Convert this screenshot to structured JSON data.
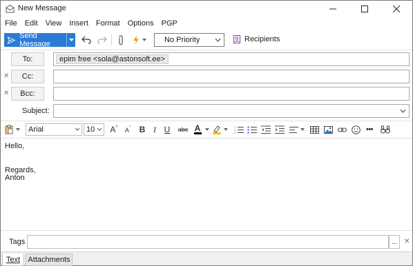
{
  "window": {
    "title": "New Message"
  },
  "menu": [
    "File",
    "Edit",
    "View",
    "Insert",
    "Format",
    "Options",
    "PGP"
  ],
  "toolbar": {
    "send_label": "Send Message",
    "priority_value": "No Priority",
    "recipients_label": "Recipients"
  },
  "header": {
    "to_label": "To:",
    "to_recipient": "epim free <sola@astonsoft.ee>",
    "cc_label": "Cc:",
    "bcc_label": "Bcc:",
    "subject_label": "Subject:",
    "subject_value": ""
  },
  "format": {
    "font_family": "Arial",
    "font_size": "10"
  },
  "body": {
    "lines": [
      "Hello,",
      "",
      "",
      "Regards,",
      "Anton"
    ]
  },
  "tags": {
    "label": "Tags",
    "more": "..."
  },
  "tabs": [
    "Text",
    "Attachments"
  ],
  "colors": {
    "accent": "#2b7bd4",
    "font_color_bar": "#000000",
    "highlight_bar": "#f0c000"
  }
}
